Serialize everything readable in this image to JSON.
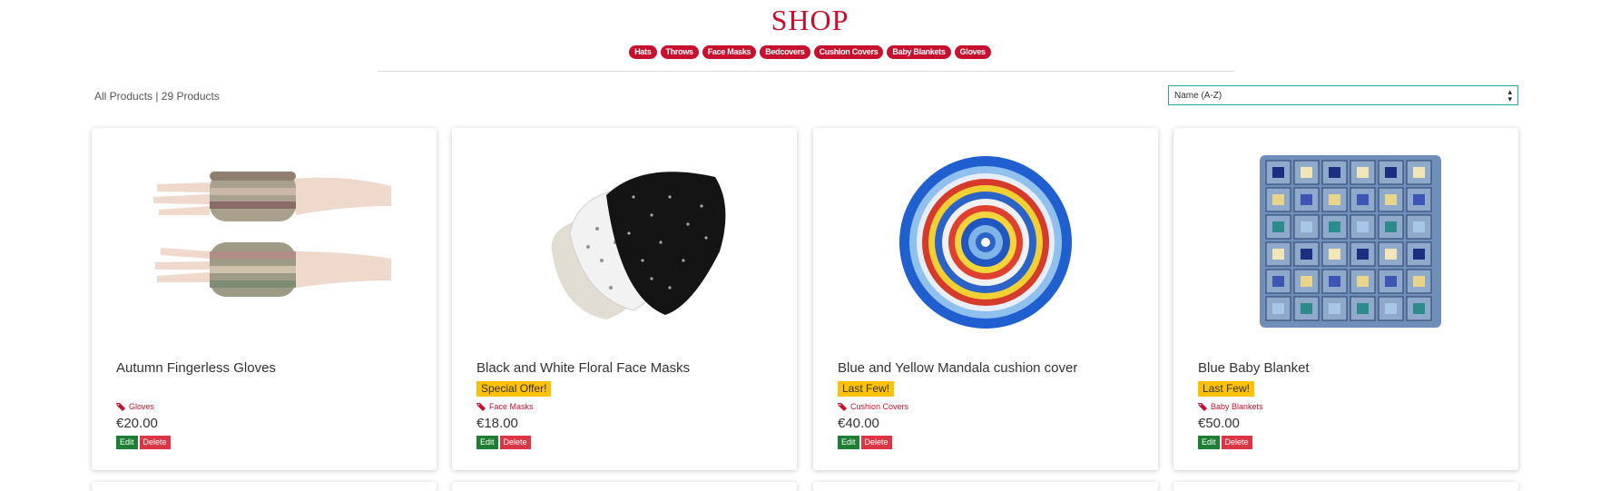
{
  "header": {
    "title": "SHOP"
  },
  "categories": [
    "Hats",
    "Throws",
    "Face Masks",
    "Bedcovers",
    "Cushion Covers",
    "Baby Blankets",
    "Gloves"
  ],
  "toolbar": {
    "count_text": "All Products | 29 Products",
    "sort_value": "Name (A-Z)"
  },
  "products": [
    {
      "name": "Autumn Fingerless Gloves",
      "badge": "",
      "category": "Gloves",
      "price": "€20.00",
      "edit": "Edit",
      "delete": "Delete",
      "image": "fingerless-gloves"
    },
    {
      "name": "Black and White Floral Face Masks",
      "badge": "Special Offer!",
      "category": "Face Masks",
      "price": "€18.00",
      "edit": "Edit",
      "delete": "Delete",
      "image": "face-masks"
    },
    {
      "name": "Blue and Yellow Mandala cushion cover",
      "badge": "Last Few!",
      "category": "Cushion Covers",
      "price": "€40.00",
      "edit": "Edit",
      "delete": "Delete",
      "image": "mandala-cushion"
    },
    {
      "name": "Blue Baby Blanket",
      "badge": "Last Few!",
      "category": "Baby Blankets",
      "price": "€50.00",
      "edit": "Edit",
      "delete": "Delete",
      "image": "granny-square-blanket"
    }
  ],
  "colors": {
    "brand": "#c8102e",
    "badge": "#ffc107",
    "edit": "#1e7e34",
    "delete": "#dc3545",
    "select_border": "#2aa5a0"
  }
}
